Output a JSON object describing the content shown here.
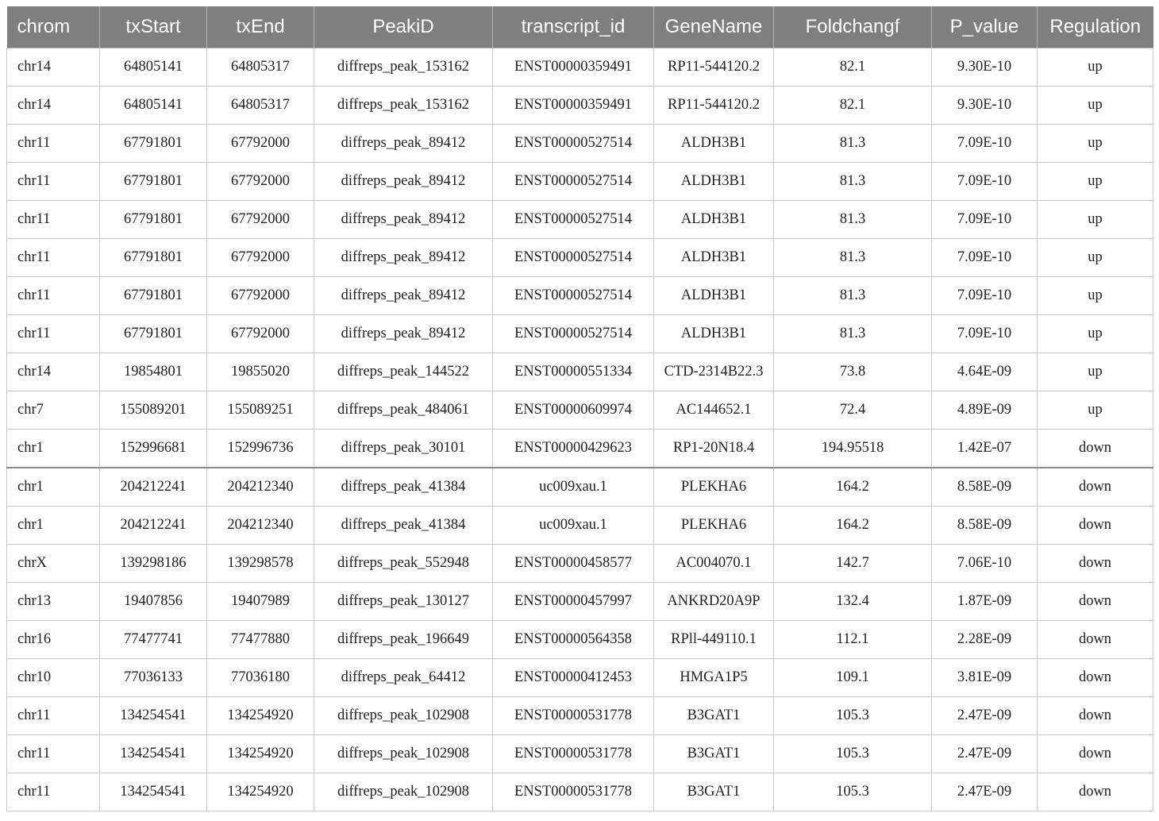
{
  "table": {
    "headers": [
      "chrom",
      "txStart",
      "txEnd",
      "PeakiD",
      "transcript_id",
      "GeneName",
      "Foldchangf",
      "P_value",
      "Regulation"
    ],
    "rows": [
      [
        "chr14",
        "64805141",
        "64805317",
        "diffreps_peak_153162",
        "ENST00000359491",
        "RP11-544120.2",
        "82.1",
        "9.30E-10",
        "up"
      ],
      [
        "chr14",
        "64805141",
        "64805317",
        "diffreps_peak_153162",
        "ENST00000359491",
        "RP11-544120.2",
        "82.1",
        "9.30E-10",
        "up"
      ],
      [
        "chr11",
        "67791801",
        "67792000",
        "diffreps_peak_89412",
        "ENST00000527514",
        "ALDH3B1",
        "81.3",
        "7.09E-10",
        "up"
      ],
      [
        "chr11",
        "67791801",
        "67792000",
        "diffreps_peak_89412",
        "ENST00000527514",
        "ALDH3B1",
        "81.3",
        "7.09E-10",
        "up"
      ],
      [
        "chr11",
        "67791801",
        "67792000",
        "diffreps_peak_89412",
        "ENST00000527514",
        "ALDH3B1",
        "81.3",
        "7.09E-10",
        "up"
      ],
      [
        "chr11",
        "67791801",
        "67792000",
        "diffreps_peak_89412",
        "ENST00000527514",
        "ALDH3B1",
        "81.3",
        "7.09E-10",
        "up"
      ],
      [
        "chr11",
        "67791801",
        "67792000",
        "diffreps_peak_89412",
        "ENST00000527514",
        "ALDH3B1",
        "81.3",
        "7.09E-10",
        "up"
      ],
      [
        "chr11",
        "67791801",
        "67792000",
        "diffreps_peak_89412",
        "ENST00000527514",
        "ALDH3B1",
        "81.3",
        "7.09E-10",
        "up"
      ],
      [
        "chr14",
        "19854801",
        "19855020",
        "diffreps_peak_144522",
        "ENST00000551334",
        "CTD-2314B22.3",
        "73.8",
        "4.64E-09",
        "up"
      ],
      [
        "chr7",
        "155089201",
        "155089251",
        "diffreps_peak_484061",
        "ENST00000609974",
        "AC144652.1",
        "72.4",
        "4.89E-09",
        "up"
      ],
      [
        "chr1",
        "152996681",
        "152996736",
        "diffreps_peak_30101",
        "ENST00000429623",
        "RP1-20N18.4",
        "194.95518",
        "1.42E-07",
        "down"
      ],
      [
        "chr1",
        "204212241",
        "204212340",
        "diffreps_peak_41384",
        "uc009xau.1",
        "PLEKHA6",
        "164.2",
        "8.58E-09",
        "down"
      ],
      [
        "chr1",
        "204212241",
        "204212340",
        "diffreps_peak_41384",
        "uc009xau.1",
        "PLEKHA6",
        "164.2",
        "8.58E-09",
        "down"
      ],
      [
        "chrX",
        "139298186",
        "139298578",
        "diffreps_peak_552948",
        "ENST00000458577",
        "AC004070.1",
        "142.7",
        "7.06E-10",
        "down"
      ],
      [
        "chr13",
        "19407856",
        "19407989",
        "diffreps_peak_130127",
        "ENST00000457997",
        "ANKRD20A9P",
        "132.4",
        "1.87E-09",
        "down"
      ],
      [
        "chr16",
        "77477741",
        "77477880",
        "diffreps_peak_196649",
        "ENST00000564358",
        "RPll-449110.1",
        "112.1",
        "2.28E-09",
        "down"
      ],
      [
        "chr10",
        "77036133",
        "77036180",
        "diffreps_peak_64412",
        "ENST00000412453",
        "HMGA1P5",
        "109.1",
        "3.81E-09",
        "down"
      ],
      [
        "chr11",
        "134254541",
        "134254920",
        "diffreps_peak_102908",
        "ENST00000531778",
        "B3GAT1",
        "105.3",
        "2.47E-09",
        "down"
      ],
      [
        "chr11",
        "134254541",
        "134254920",
        "diffreps_peak_102908",
        "ENST00000531778",
        "B3GAT1",
        "105.3",
        "2.47E-09",
        "down"
      ],
      [
        "chr11",
        "134254541",
        "134254920",
        "diffreps_peak_102908",
        "ENST00000531778",
        "B3GAT1",
        "105.3",
        "2.47E-09",
        "down"
      ]
    ]
  },
  "colors": {
    "header_background": "#7f7f7f",
    "header_text": "#ffffff",
    "grid_line": "#c8c8c8"
  }
}
